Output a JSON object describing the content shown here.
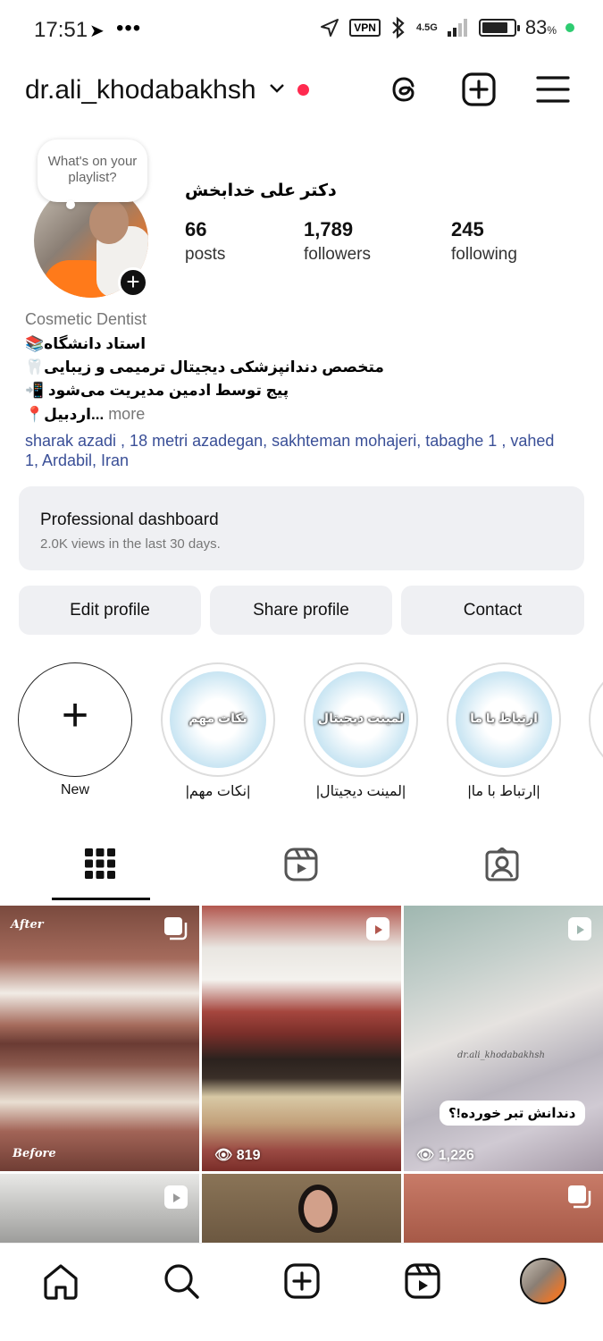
{
  "status_bar": {
    "time": "17:51",
    "nav_glyph": "➤",
    "dots": "•••",
    "vpn": "VPN",
    "network": "4.5G",
    "battery_percent": "83",
    "battery_symbol": "%",
    "battery_level": 0.83
  },
  "header": {
    "username": "dr.ali_khodabakhsh",
    "icons": [
      "threads-icon",
      "create-icon",
      "menu-icon"
    ]
  },
  "profile": {
    "note_bubble": "What's on your playlist?",
    "display_name": "دکتر علی خدابخش",
    "stats": [
      {
        "num": "66",
        "label": "posts"
      },
      {
        "num": "1,789",
        "label": "followers"
      },
      {
        "num": "245",
        "label": "following"
      }
    ],
    "category": "Cosmetic Dentist",
    "bio_lines": [
      "📚استاد دانشگاه",
      "🦷متخصص دندانپزشکی دیجیتال ترمیمی و زیبایی",
      "📲 پیج توسط ادمین مدیریت می‌شود",
      "📍اردبیل..."
    ],
    "more": " more",
    "address": "sharak azadi , 18 metri azadegan, sakhteman mohajeri, tabaghe 1 , vahed 1, Ardabil, Iran"
  },
  "dashboard": {
    "title": "Professional dashboard",
    "subtitle": "2.0K views in the last 30 days."
  },
  "buttons": {
    "edit": "Edit profile",
    "share": "Share profile",
    "contact": "Contact"
  },
  "highlights": {
    "new_label": "New",
    "items": [
      {
        "cover_text": "نکات مهم",
        "label": "|نکات مهم|"
      },
      {
        "cover_text": "لمینت دیجیتال",
        "label": "|لمینت دیجیتال|"
      },
      {
        "cover_text": "ارتباط با ما",
        "label": "|ارتباط با ما|"
      }
    ]
  },
  "tabs": [
    "grid-tab",
    "reels-tab",
    "tagged-tab"
  ],
  "posts": [
    {
      "type": "carousel",
      "top_tag": "After",
      "bottom_tag": "Before"
    },
    {
      "type": "reel",
      "views": "819"
    },
    {
      "type": "reel",
      "views": "1,226",
      "overlay": "دندانش تبر خورده!؟",
      "watermark": "dr.ali_khodabakhsh"
    },
    {
      "type": "reel"
    },
    {
      "type": "photo"
    },
    {
      "type": "carousel"
    }
  ],
  "colors": {
    "accent_red": "#ff2a4f",
    "link_blue": "#3a4f97",
    "button_bg": "#eff0f3",
    "status_green": "#2ecc71"
  }
}
